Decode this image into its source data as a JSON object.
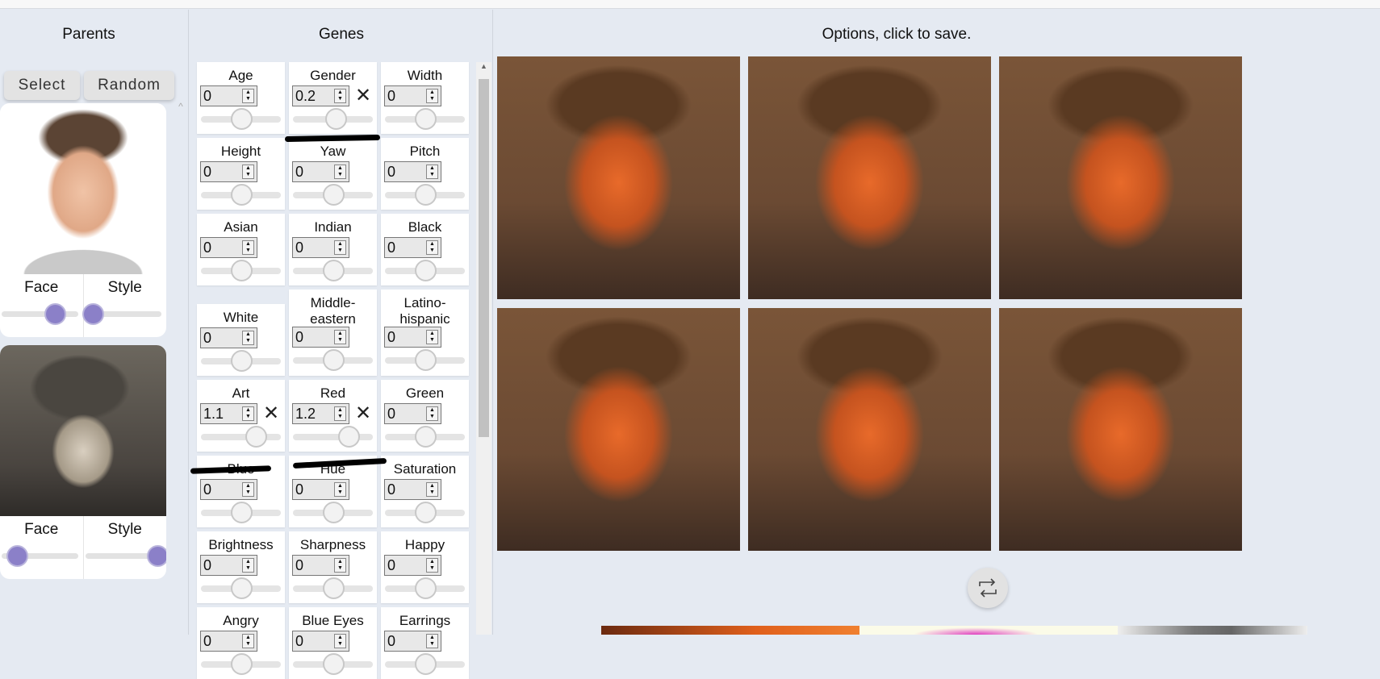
{
  "parents": {
    "title": "Parents",
    "select_label": "Select",
    "random_label": "Random",
    "items": [
      {
        "face_label": "Face",
        "style_label": "Style",
        "face": 0.7,
        "style": 0.1
      },
      {
        "face_label": "Face",
        "style_label": "Style",
        "face": 0.2,
        "style": 0.95
      }
    ]
  },
  "genes": {
    "title": "Genes",
    "range": [
      -3,
      3
    ],
    "items": [
      {
        "label": "Age",
        "value": "0"
      },
      {
        "label": "Gender",
        "value": "0.2",
        "clear": true
      },
      {
        "label": "Width",
        "value": "0"
      },
      {
        "label": "Height",
        "value": "0"
      },
      {
        "label": "Yaw",
        "value": "0"
      },
      {
        "label": "Pitch",
        "value": "0"
      },
      {
        "label": "Asian",
        "value": "0"
      },
      {
        "label": "Indian",
        "value": "0"
      },
      {
        "label": "Black",
        "value": "0"
      },
      {
        "label": "White",
        "value": "0"
      },
      {
        "label": "Middle-eastern",
        "value": "0"
      },
      {
        "label": "Latino-hispanic",
        "value": "0"
      },
      {
        "label": "Art",
        "value": "1.1",
        "clear": true
      },
      {
        "label": "Red",
        "value": "1.2",
        "clear": true
      },
      {
        "label": "Green",
        "value": "0"
      },
      {
        "label": "Blue",
        "value": "0"
      },
      {
        "label": "Hue",
        "value": "0"
      },
      {
        "label": "Saturation",
        "value": "0"
      },
      {
        "label": "Brightness",
        "value": "0"
      },
      {
        "label": "Sharpness",
        "value": "0"
      },
      {
        "label": "Happy",
        "value": "0"
      },
      {
        "label": "Angry",
        "value": "0"
      },
      {
        "label": "Blue Eyes",
        "value": "0"
      },
      {
        "label": "Earrings",
        "value": "0"
      }
    ]
  },
  "options": {
    "title": "Options, click to save.",
    "count": 6
  },
  "icons": {
    "clear": "close-icon",
    "refresh": "repeat-icon"
  }
}
